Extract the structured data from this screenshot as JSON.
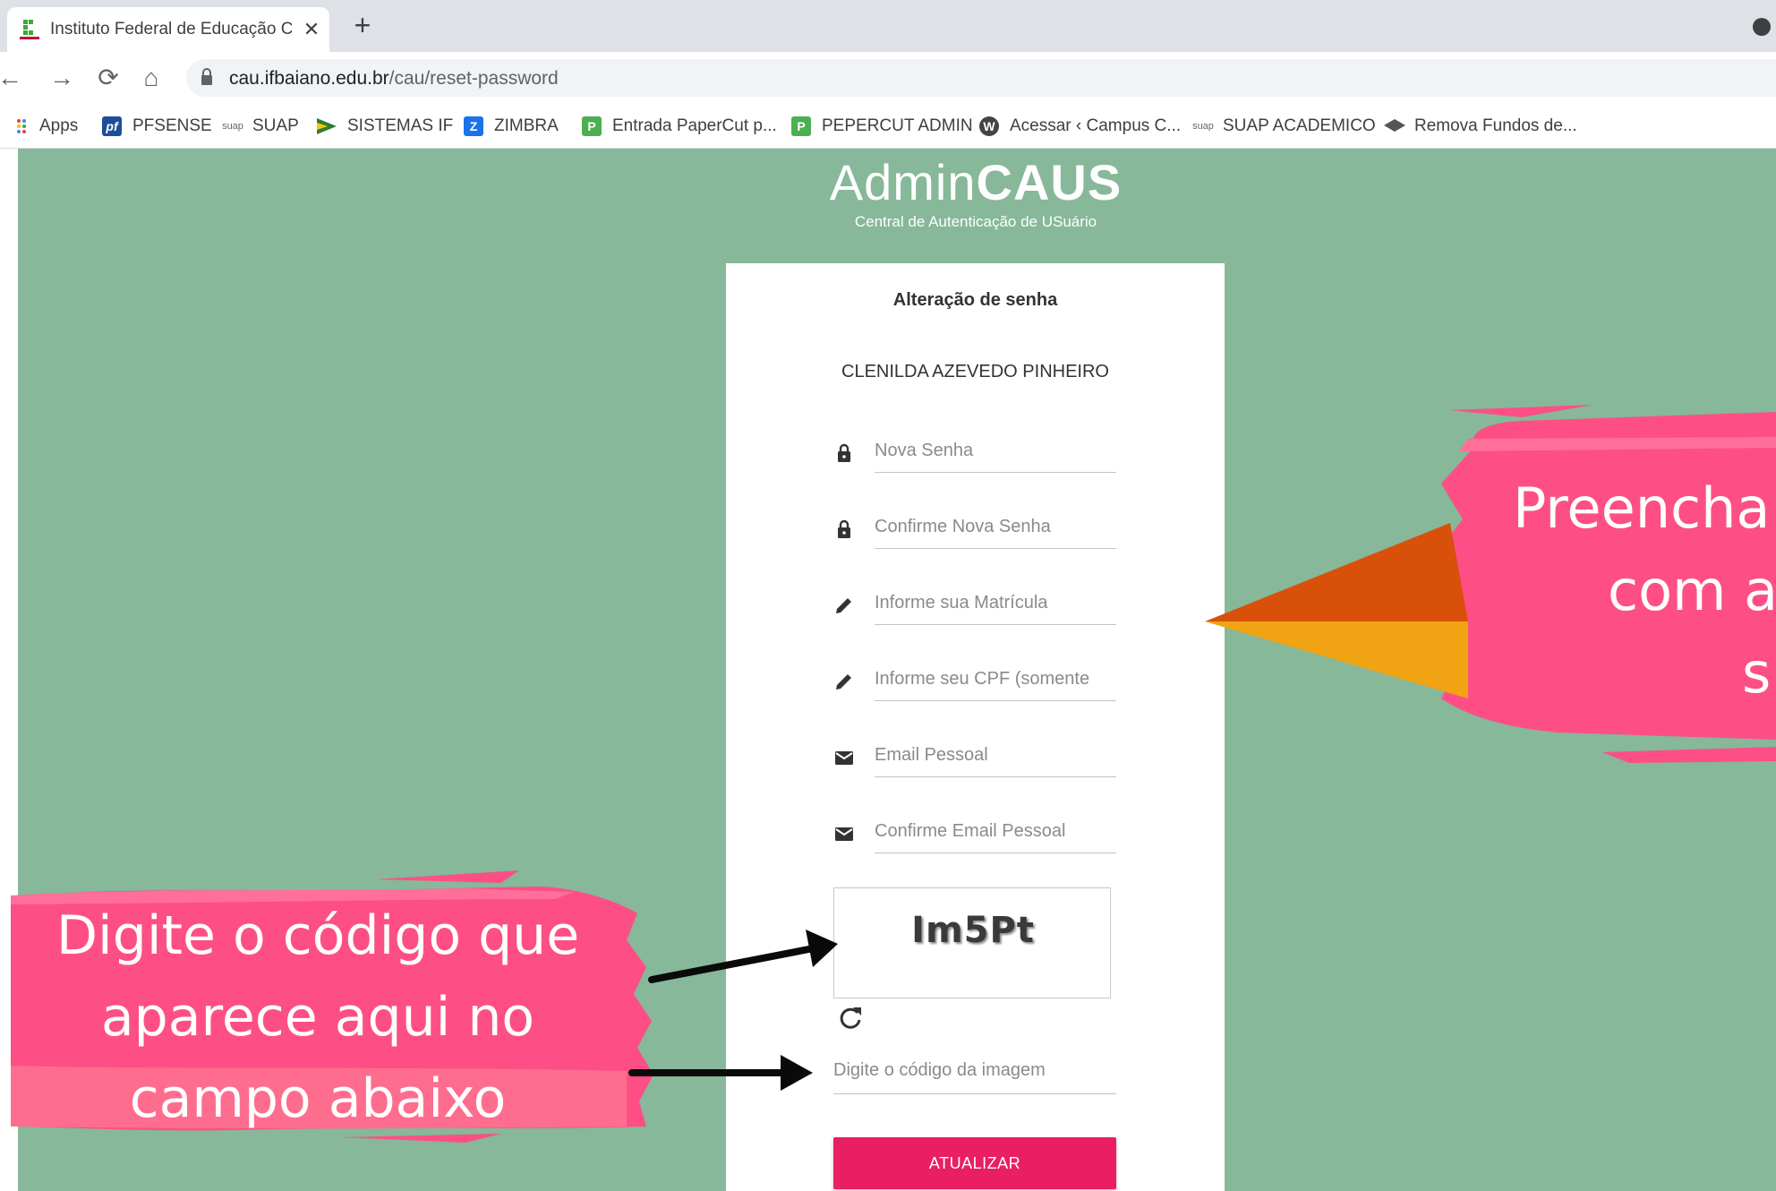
{
  "browser": {
    "tab_title": "Instituto Federal de Educação Ciê",
    "tab_close": "✕",
    "new_tab": "+",
    "url_domain": "cau.ifbaiano.edu.br",
    "url_path": "/cau/reset-password",
    "bookmarks": [
      {
        "label": "Apps",
        "icon": "apps-grid-icon"
      },
      {
        "label": "PFSENSE",
        "icon": "pfsense-icon"
      },
      {
        "label": "SUAP",
        "icon": "suap-icon"
      },
      {
        "label": "SISTEMAS IF",
        "icon": "sistemas-if-icon"
      },
      {
        "label": "ZIMBRA",
        "icon": "zimbra-icon"
      },
      {
        "label": "Entrada PaperCut p...",
        "icon": "papercut-icon"
      },
      {
        "label": "PEPERCUT ADMIN",
        "icon": "papercut-icon"
      },
      {
        "label": "Acessar ‹ Campus C...",
        "icon": "wordpress-icon"
      },
      {
        "label": "SUAP ACADEMICO",
        "icon": "suap-icon"
      },
      {
        "label": "Remova Fundos de...",
        "icon": "removebg-icon"
      }
    ]
  },
  "brand": {
    "title_light": "Admin",
    "title_bold": "CAUS",
    "subtitle": "Central de Autenticação de USuário"
  },
  "form": {
    "title": "Alteração de senha",
    "user_name": "CLENILDA AZEVEDO PINHEIRO",
    "fields": [
      {
        "placeholder": "Nova Senha",
        "icon": "lock-icon"
      },
      {
        "placeholder": "Confirme Nova Senha",
        "icon": "lock-icon"
      },
      {
        "placeholder": "Informe sua Matrícula",
        "icon": "pencil-icon"
      },
      {
        "placeholder": "Informe seu CPF (somente",
        "icon": "pencil-icon"
      },
      {
        "placeholder": "Email Pessoal",
        "icon": "mail-icon"
      },
      {
        "placeholder": "Confirme Email Pessoal",
        "icon": "mail-icon"
      }
    ],
    "captcha_code": "Im5Pt",
    "captcha_placeholder": "Digite o código da imagem",
    "submit_label": "ATUALIZAR"
  },
  "annotations": {
    "left_lines": [
      "Digite o código que",
      "aparece aqui no",
      "campo abaixo"
    ],
    "right_lines": [
      "Preencha",
      "com a",
      "s"
    ],
    "colors": {
      "pink": "#fd4f86",
      "orange": "#d9500b",
      "yellow": "#f0a414"
    }
  },
  "colors": {
    "page_bg": "#86b899",
    "button": "#e91e63"
  }
}
